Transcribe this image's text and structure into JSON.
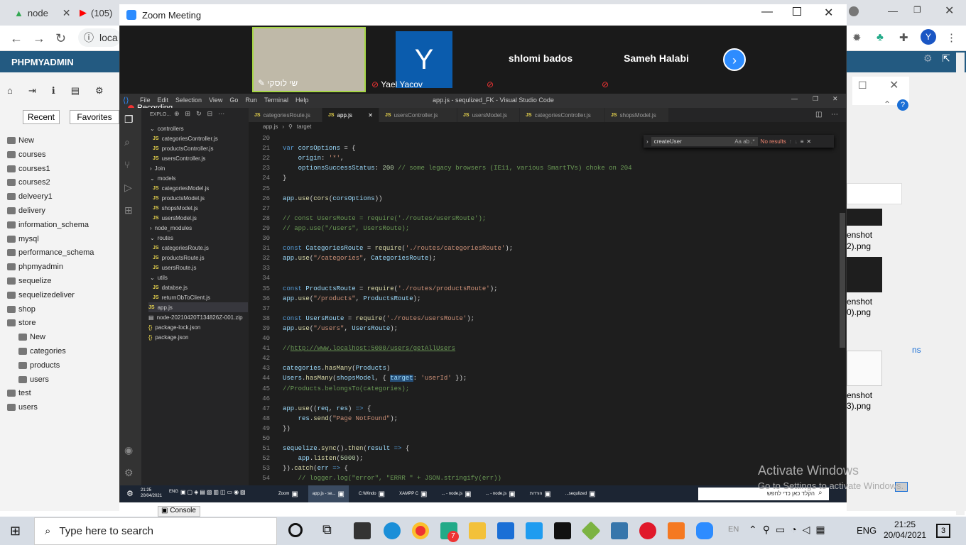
{
  "browser": {
    "tabs": [
      {
        "label": "node"
      },
      {
        "label": "(105)"
      }
    ],
    "url_partial": "loca"
  },
  "pma": {
    "title": "PHPMYADMIN",
    "recent_label": "Recent",
    "favorites_label": "Favorites",
    "tree": [
      "New",
      "courses",
      "courses1",
      "courses2",
      "delveery1",
      "delivery",
      "information_schema",
      "mysql",
      "performance_schema",
      "phpmyadmin",
      "sequelize",
      "sequelizedeliver",
      "shop",
      "store",
      "New",
      "categories",
      "products",
      "users",
      "test",
      "users"
    ],
    "console_label": "Console"
  },
  "zoom": {
    "title": "Zoom Meeting",
    "participants": [
      {
        "name": "שי לוסקי"
      },
      {
        "name": "Yael Yacov",
        "initial": "Y"
      },
      {
        "name": "shlomi bados"
      },
      {
        "name": "Sameh Halabi"
      }
    ],
    "recording_label": "Recording"
  },
  "vscode": {
    "menu": [
      "File",
      "Edit",
      "Selection",
      "View",
      "Go",
      "Run",
      "Terminal",
      "Help"
    ],
    "window_title": "app.js - sequlized_FK - Visual Studio Code",
    "explorer_label": "EXPLO...",
    "tree": [
      {
        "label": "controllers",
        "type": "folder"
      },
      {
        "label": "categoriesController.js",
        "type": "js"
      },
      {
        "label": "productsController.js",
        "type": "js"
      },
      {
        "label": "usersController.js",
        "type": "js"
      },
      {
        "label": "Join",
        "type": "folder-closed"
      },
      {
        "label": "models",
        "type": "folder"
      },
      {
        "label": "categoriesModel.js",
        "type": "js"
      },
      {
        "label": "productsModel.js",
        "type": "js"
      },
      {
        "label": "shopsModel.js",
        "type": "js"
      },
      {
        "label": "usersModel.js",
        "type": "js"
      },
      {
        "label": "node_modules",
        "type": "folder-closed"
      },
      {
        "label": "routes",
        "type": "folder"
      },
      {
        "label": "categoriesRoute.js",
        "type": "js"
      },
      {
        "label": "productsRoute.js",
        "type": "js"
      },
      {
        "label": "usersRoute.js",
        "type": "js"
      },
      {
        "label": "utils",
        "type": "folder"
      },
      {
        "label": "databse.js",
        "type": "js"
      },
      {
        "label": "returnObToClient.js",
        "type": "js"
      },
      {
        "label": "app.js",
        "type": "js"
      },
      {
        "label": "node-20210420T134826Z-001.zip",
        "type": "zip"
      },
      {
        "label": "package-lock.json",
        "type": "json"
      },
      {
        "label": "package.json",
        "type": "json"
      }
    ],
    "tabs": [
      {
        "label": "categoriesRoute.js"
      },
      {
        "label": "app.js"
      },
      {
        "label": "usersController.js"
      },
      {
        "label": "usersModel.js"
      },
      {
        "label": "categoriesController.js"
      },
      {
        "label": "shopsModel.js"
      }
    ],
    "breadcrumb": [
      "app.js",
      "target"
    ],
    "find": {
      "value": "createUser",
      "status": "No results"
    },
    "code": [
      {
        "n": "20",
        "html": ""
      },
      {
        "n": "21",
        "html": "<span class=\"kw\">var</span> <span class=\"var\">corsOptions</span> = {"
      },
      {
        "n": "22",
        "html": "    <span class=\"var\">origin</span>: <span class=\"str\">'*'</span>,"
      },
      {
        "n": "23",
        "html": "    <span class=\"var\">optionsSuccessStatus</span>: <span class=\"num\">200</span> <span class=\"com\">// some legacy browsers (IE11, various SmartTVs) choke on 204</span>"
      },
      {
        "n": "24",
        "html": "}"
      },
      {
        "n": "25",
        "html": ""
      },
      {
        "n": "26",
        "html": "<span class=\"var\">app</span>.<span class=\"fn\">use</span>(<span class=\"fn\">cors</span>(<span class=\"var\">corsOptions</span>))"
      },
      {
        "n": "27",
        "html": ""
      },
      {
        "n": "28",
        "html": "<span class=\"com\">// const UsersRoute = require('./routes/usersRoute');</span>"
      },
      {
        "n": "29",
        "html": "<span class=\"com\">// app.use(\"/users\", UsersRoute);</span>"
      },
      {
        "n": "30",
        "html": ""
      },
      {
        "n": "31",
        "html": "<span class=\"kw\">const</span> <span class=\"var\">CategoriesRoute</span> = <span class=\"fn\">require</span>(<span class=\"str\">'./routes/categoriesRoute'</span>);"
      },
      {
        "n": "32",
        "html": "<span class=\"var\">app</span>.<span class=\"fn\">use</span>(<span class=\"str\">\"/categories\"</span>, <span class=\"var\">CategoriesRoute</span>);"
      },
      {
        "n": "33",
        "html": ""
      },
      {
        "n": "34",
        "html": ""
      },
      {
        "n": "35",
        "html": "<span class=\"kw\">const</span> <span class=\"var\">ProductsRoute</span> = <span class=\"fn\">require</span>(<span class=\"str\">'./routes/productsRoute'</span>);"
      },
      {
        "n": "36",
        "html": "<span class=\"var\">app</span>.<span class=\"fn\">use</span>(<span class=\"str\">\"/products\"</span>, <span class=\"var\">ProductsRoute</span>);"
      },
      {
        "n": "37",
        "html": ""
      },
      {
        "n": "38",
        "html": "<span class=\"kw\">const</span> <span class=\"var\">UsersRoute</span> = <span class=\"fn\">require</span>(<span class=\"str\">'./routes/usersRoute'</span>);"
      },
      {
        "n": "39",
        "html": "<span class=\"var\">app</span>.<span class=\"fn\">use</span>(<span class=\"str\">\"/users\"</span>, <span class=\"var\">UsersRoute</span>);"
      },
      {
        "n": "40",
        "html": ""
      },
      {
        "n": "41",
        "html": "<span class=\"com\">//<u>http://www.localhost:5000/users/getAllUsers</u></span>"
      },
      {
        "n": "42",
        "html": ""
      },
      {
        "n": "43",
        "html": "<span class=\"var\">categories</span>.<span class=\"fn\">hasMany</span>(<span class=\"var\">Products</span>)"
      },
      {
        "n": "44",
        "html": "<span class=\"var\">Users</span>.<span class=\"fn\">hasMany</span>(<span class=\"var\">shopsModel</span>, { <span class=\"var\" style=\"background:#264f78\">target</span>: <span class=\"str\">'userId'</span> });"
      },
      {
        "n": "45",
        "html": "<span class=\"com\">//Products.belongsTo(categories);</span>"
      },
      {
        "n": "46",
        "html": ""
      },
      {
        "n": "47",
        "html": "<span class=\"var\">app</span>.<span class=\"fn\">use</span>((<span class=\"var\">req</span>, <span class=\"var\">res</span>) <span class=\"kw\">=&gt;</span> {"
      },
      {
        "n": "48",
        "html": "    <span class=\"var\">res</span>.<span class=\"fn\">send</span>(<span class=\"str\">\"Page NotFound\"</span>);"
      },
      {
        "n": "49",
        "html": "})"
      },
      {
        "n": "50",
        "html": ""
      },
      {
        "n": "51",
        "html": "<span class=\"var\">sequelize</span>.<span class=\"fn\">sync</span>().<span class=\"fn\">then</span>(<span class=\"var\">result</span> <span class=\"kw\">=&gt;</span> {"
      },
      {
        "n": "52",
        "html": "    <span class=\"var\">app</span>.<span class=\"fn\">listen</span>(<span class=\"num\">5000</span>);"
      },
      {
        "n": "53",
        "html": "}).<span class=\"fn\">catch</span>(<span class=\"var\">err</span> <span class=\"kw\">=&gt;</span> {"
      },
      {
        "n": "54",
        "html": "    <span class=\"com\">// logger.log(\"error\", \"ERRR \" + JSON.stringify(err))</span>"
      }
    ]
  },
  "inner_taskbar": {
    "time": "21:25",
    "date": "20/04/2021",
    "lang": "ENG",
    "items": [
      "Zoom",
      "app.js - se...",
      "C:\\Windo",
      "XAMPP C",
      "... - node.js",
      "... - node.js",
      "הורדות",
      "...sequlized"
    ],
    "search_placeholder": "הקלד כאן כדי לחפש"
  },
  "right_panel": {
    "files": [
      "enshot",
      "2).png",
      "enshot",
      "0).png",
      "enshot",
      "3).png"
    ],
    "ns": "ns"
  },
  "watermark": {
    "line1": "Activate Windows",
    "line2": "Go to Settings to activate Windows."
  },
  "taskbar": {
    "search_placeholder": "Type here to search",
    "lang": "ENG",
    "time": "21:25",
    "date": "20/04/2021",
    "notif": "3",
    "mail_badge": "7"
  }
}
